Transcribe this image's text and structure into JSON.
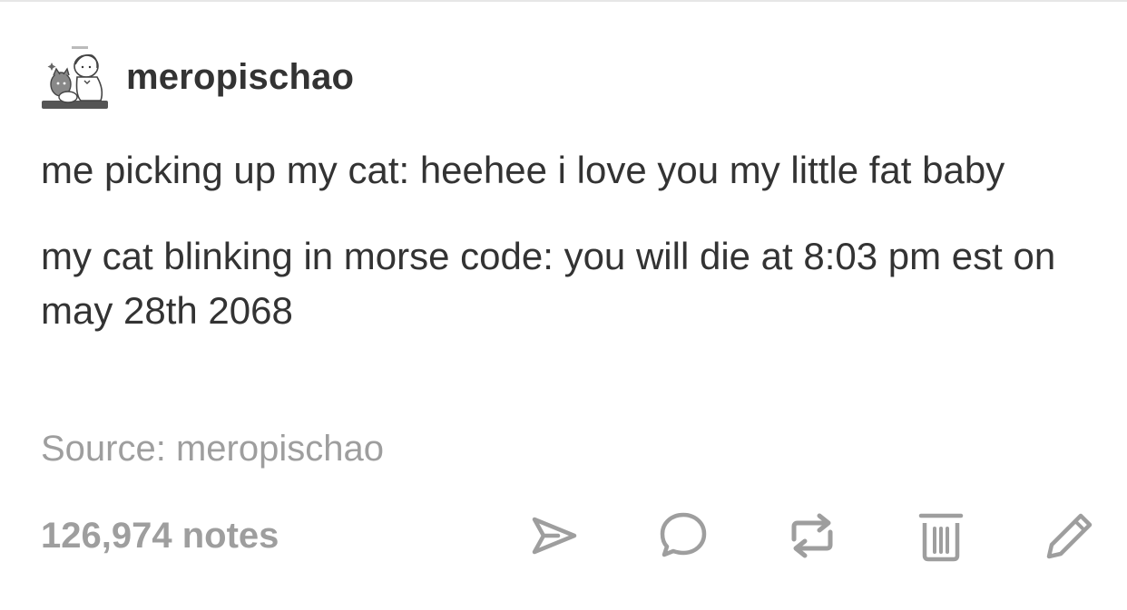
{
  "post": {
    "username": "meropischao",
    "avatar_icon": "avatar-drawing",
    "paragraphs": [
      "me picking up my cat: heehee i love you my little fat baby",
      "my cat blinking in morse code: you will die at 8:03 pm est on may 28th 2068"
    ],
    "source": "Source: meropischao",
    "notes": "126,974 notes"
  },
  "actions": [
    {
      "name": "share-button",
      "icon": "send-icon"
    },
    {
      "name": "reply-button",
      "icon": "comment-icon"
    },
    {
      "name": "reblog-button",
      "icon": "reblog-icon"
    },
    {
      "name": "delete-button",
      "icon": "trash-icon"
    },
    {
      "name": "edit-button",
      "icon": "pencil-icon"
    }
  ],
  "colors": {
    "text": "#333333",
    "muted": "#9e9e9e",
    "icon": "#9e9e9e"
  }
}
